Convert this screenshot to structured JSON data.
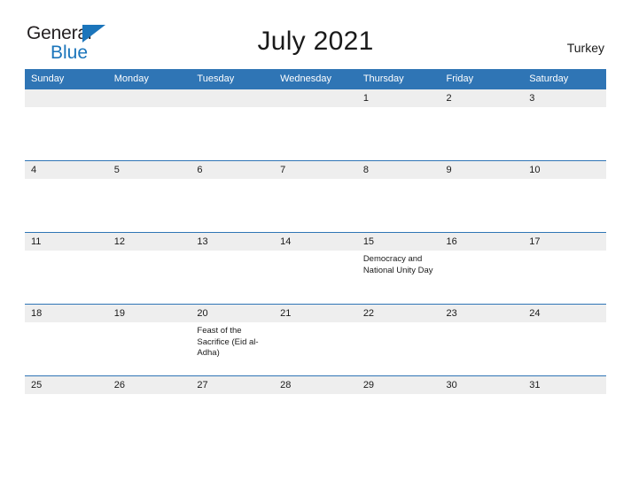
{
  "brand": {
    "name_part1": "General",
    "name_part2": "Blue",
    "triangle_color": "#1b75bb",
    "text_color": "#231f20"
  },
  "header": {
    "title": "July 2021",
    "country": "Turkey"
  },
  "calendar": {
    "header_bg": "#2f75b5",
    "date_band_bg": "#eeeeee",
    "weekday_headers": [
      "Sunday",
      "Monday",
      "Tuesday",
      "Wednesday",
      "Thursday",
      "Friday",
      "Saturday"
    ],
    "weeks": [
      {
        "days": [
          {
            "date": "",
            "events": []
          },
          {
            "date": "",
            "events": []
          },
          {
            "date": "",
            "events": []
          },
          {
            "date": "",
            "events": []
          },
          {
            "date": "1",
            "events": []
          },
          {
            "date": "2",
            "events": []
          },
          {
            "date": "3",
            "events": []
          }
        ]
      },
      {
        "days": [
          {
            "date": "4",
            "events": []
          },
          {
            "date": "5",
            "events": []
          },
          {
            "date": "6",
            "events": []
          },
          {
            "date": "7",
            "events": []
          },
          {
            "date": "8",
            "events": []
          },
          {
            "date": "9",
            "events": []
          },
          {
            "date": "10",
            "events": []
          }
        ]
      },
      {
        "days": [
          {
            "date": "11",
            "events": []
          },
          {
            "date": "12",
            "events": []
          },
          {
            "date": "13",
            "events": []
          },
          {
            "date": "14",
            "events": []
          },
          {
            "date": "15",
            "events": [
              "Democracy and National Unity Day"
            ]
          },
          {
            "date": "16",
            "events": []
          },
          {
            "date": "17",
            "events": []
          }
        ]
      },
      {
        "days": [
          {
            "date": "18",
            "events": []
          },
          {
            "date": "19",
            "events": []
          },
          {
            "date": "20",
            "events": [
              "Feast of the Sacrifice (Eid al-Adha)"
            ]
          },
          {
            "date": "21",
            "events": []
          },
          {
            "date": "22",
            "events": []
          },
          {
            "date": "23",
            "events": []
          },
          {
            "date": "24",
            "events": []
          }
        ]
      },
      {
        "days": [
          {
            "date": "25",
            "events": []
          },
          {
            "date": "26",
            "events": []
          },
          {
            "date": "27",
            "events": []
          },
          {
            "date": "28",
            "events": []
          },
          {
            "date": "29",
            "events": []
          },
          {
            "date": "30",
            "events": []
          },
          {
            "date": "31",
            "events": []
          }
        ]
      }
    ]
  }
}
